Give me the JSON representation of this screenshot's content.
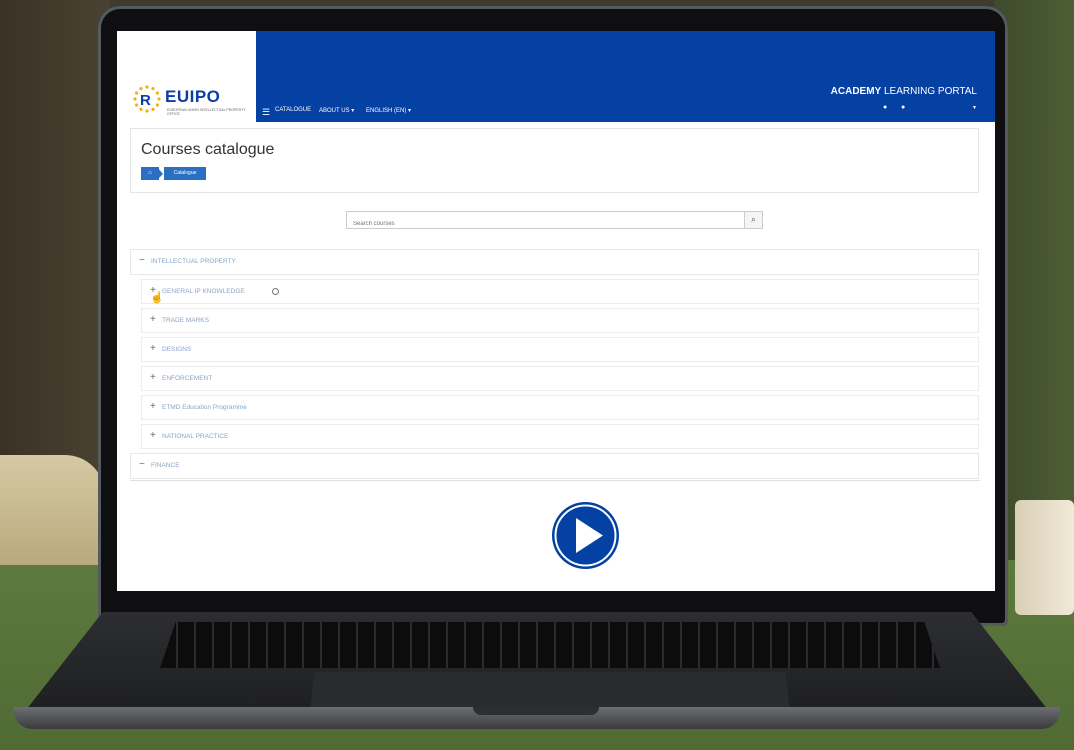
{
  "header": {
    "logo_text": "EUIPO",
    "logo_sub": "EUROPEAN UNION INTELLECTUAL PROPERTY OFFICE",
    "nav": [
      "CATALOGUE",
      "ABOUT US ▾",
      "ENGLISH (EN) ▾"
    ],
    "portal_bold": "ACADEMY",
    "portal_rest": "LEARNING PORTAL"
  },
  "page": {
    "title": "Courses catalogue",
    "breadcrumb": "Catalogue"
  },
  "search": {
    "placeholder": "Search courses"
  },
  "categories": {
    "intellectual_property": "INTELLECTUAL PROPERTY",
    "subcategories": [
      "GENERAL IP KNOWLEDGE",
      "TRADE MARKS",
      "DESIGNS",
      "ENFORCEMENT",
      "ETMD Education Programme",
      "NATIONAL PRACTICE"
    ],
    "finance": "FINANCE"
  },
  "icons": {
    "expand": "+",
    "collapse": "−",
    "brand_blue": "#0441a2",
    "breadcrumb_blue": "#2b6fc2"
  }
}
